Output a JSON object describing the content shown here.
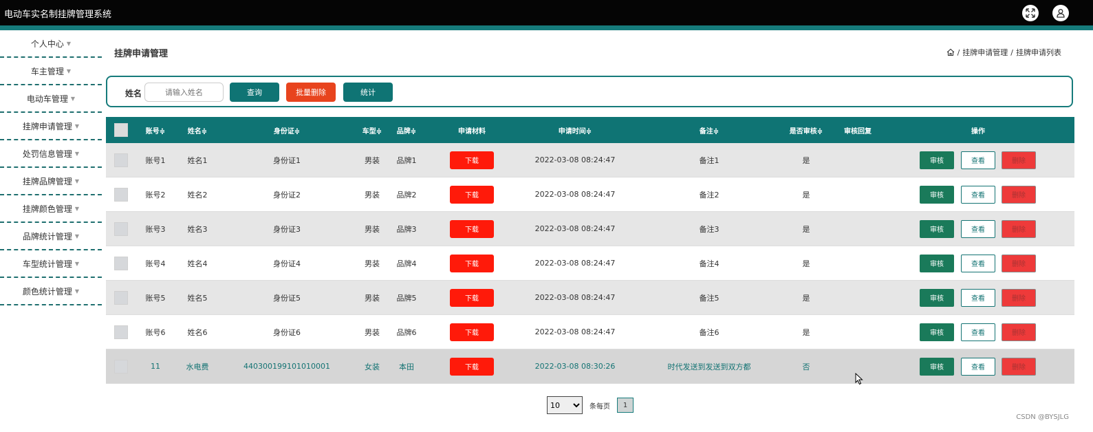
{
  "app_title": "电动车实名制挂牌管理系统",
  "header_icons": [
    "fullscreen-icon",
    "user-icon"
  ],
  "sidebar": {
    "items": [
      {
        "label": "个人中心"
      },
      {
        "label": "车主管理"
      },
      {
        "label": "电动车管理"
      },
      {
        "label": "挂牌申请管理"
      },
      {
        "label": "处罚信息管理"
      },
      {
        "label": "挂牌品牌管理"
      },
      {
        "label": "挂牌颜色管理"
      },
      {
        "label": "品牌统计管理"
      },
      {
        "label": "车型统计管理"
      },
      {
        "label": "颜色统计管理"
      }
    ]
  },
  "page": {
    "title": "挂牌申请管理",
    "breadcrumb": [
      "挂牌申请管理",
      "挂牌申请列表"
    ]
  },
  "search": {
    "label": "姓名",
    "placeholder": "请输入姓名",
    "query_label": "查询",
    "batch_delete_label": "批量删除",
    "stats_label": "统计"
  },
  "table": {
    "headers": {
      "account": "账号≑",
      "name": "姓名≑",
      "id_card": "身份证≑",
      "car_type": "车型≑",
      "brand": "品牌≑",
      "material": "申请材料",
      "apply_time": "申请时间≑",
      "remark": "备注≑",
      "reviewed": "是否审核≑",
      "reply": "审核回复",
      "ops": "操作"
    },
    "download_label": "下载",
    "review_label": "审核",
    "view_label": "查看",
    "delete_label": "删除",
    "rows": [
      {
        "account": "账号1",
        "name": "姓名1",
        "id_card": "身份证1",
        "car_type": "男装",
        "brand": "品牌1",
        "apply_time": "2022-03-08 08:24:47",
        "remark": "备注1",
        "reviewed": "是",
        "reply": ""
      },
      {
        "account": "账号2",
        "name": "姓名2",
        "id_card": "身份证2",
        "car_type": "男装",
        "brand": "品牌2",
        "apply_time": "2022-03-08 08:24:47",
        "remark": "备注2",
        "reviewed": "是",
        "reply": ""
      },
      {
        "account": "账号3",
        "name": "姓名3",
        "id_card": "身份证3",
        "car_type": "男装",
        "brand": "品牌3",
        "apply_time": "2022-03-08 08:24:47",
        "remark": "备注3",
        "reviewed": "是",
        "reply": ""
      },
      {
        "account": "账号4",
        "name": "姓名4",
        "id_card": "身份证4",
        "car_type": "男装",
        "brand": "品牌4",
        "apply_time": "2022-03-08 08:24:47",
        "remark": "备注4",
        "reviewed": "是",
        "reply": ""
      },
      {
        "account": "账号5",
        "name": "姓名5",
        "id_card": "身份证5",
        "car_type": "男装",
        "brand": "品牌5",
        "apply_time": "2022-03-08 08:24:47",
        "remark": "备注5",
        "reviewed": "是",
        "reply": ""
      },
      {
        "account": "账号6",
        "name": "姓名6",
        "id_card": "身份证6",
        "car_type": "男装",
        "brand": "品牌6",
        "apply_time": "2022-03-08 08:24:47",
        "remark": "备注6",
        "reviewed": "是",
        "reply": ""
      },
      {
        "account": "11",
        "name": "水电费",
        "id_card": "440300199101010001",
        "car_type": "女装",
        "brand": "本田",
        "apply_time": "2022-03-08 08:30:26",
        "remark": "时代发送到发送到双方都",
        "reviewed": "否",
        "reply": ""
      }
    ]
  },
  "pagination": {
    "page_size": "10",
    "per_page_label": "条每页",
    "current_page": "1"
  },
  "watermark": "CSDN @BYSJLG",
  "colors": {
    "topbar": "#050505",
    "accent": "#167b7b",
    "danger": "#ff1a0a"
  }
}
